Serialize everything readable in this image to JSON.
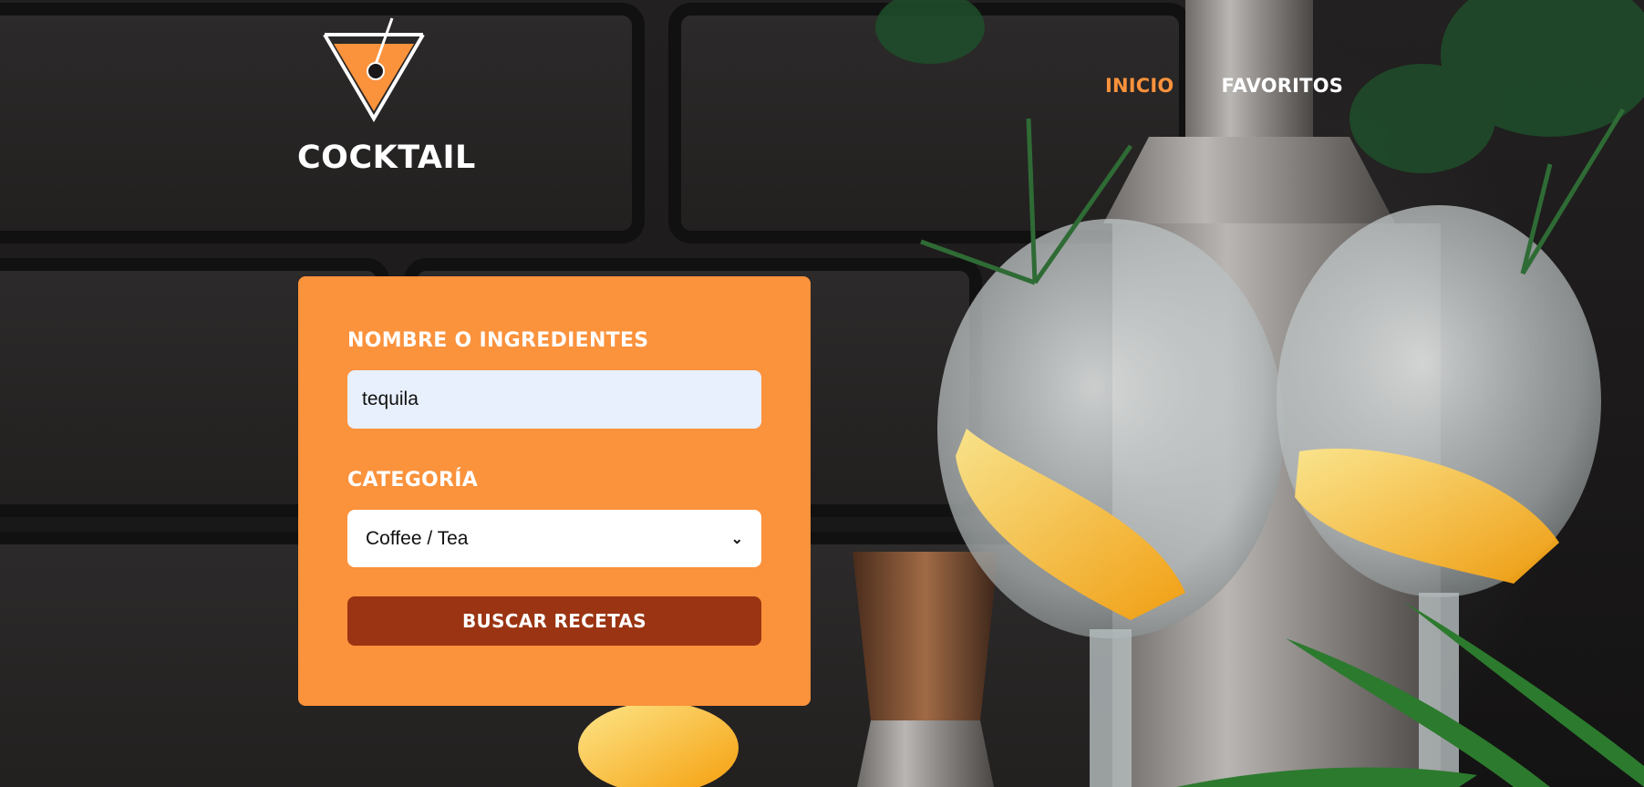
{
  "brand": {
    "logo_text": "COCKTAIL"
  },
  "nav": [
    {
      "label": "INICIO",
      "active": true
    },
    {
      "label": "FAVORITOS",
      "active": false
    }
  ],
  "form": {
    "name_label": "NOMBRE O INGREDIENTES",
    "name_value": "tequila",
    "category_label": "CATEGORÍA",
    "category_value": "Coffee / Tea",
    "submit_label": "BUSCAR RECETAS"
  },
  "colors": {
    "accent": "#fb923c",
    "button": "#9a3412",
    "input_bg": "#e8f0fe"
  },
  "icons": {
    "logo": "martini-glass-icon",
    "select": "chevron-down-icon"
  }
}
